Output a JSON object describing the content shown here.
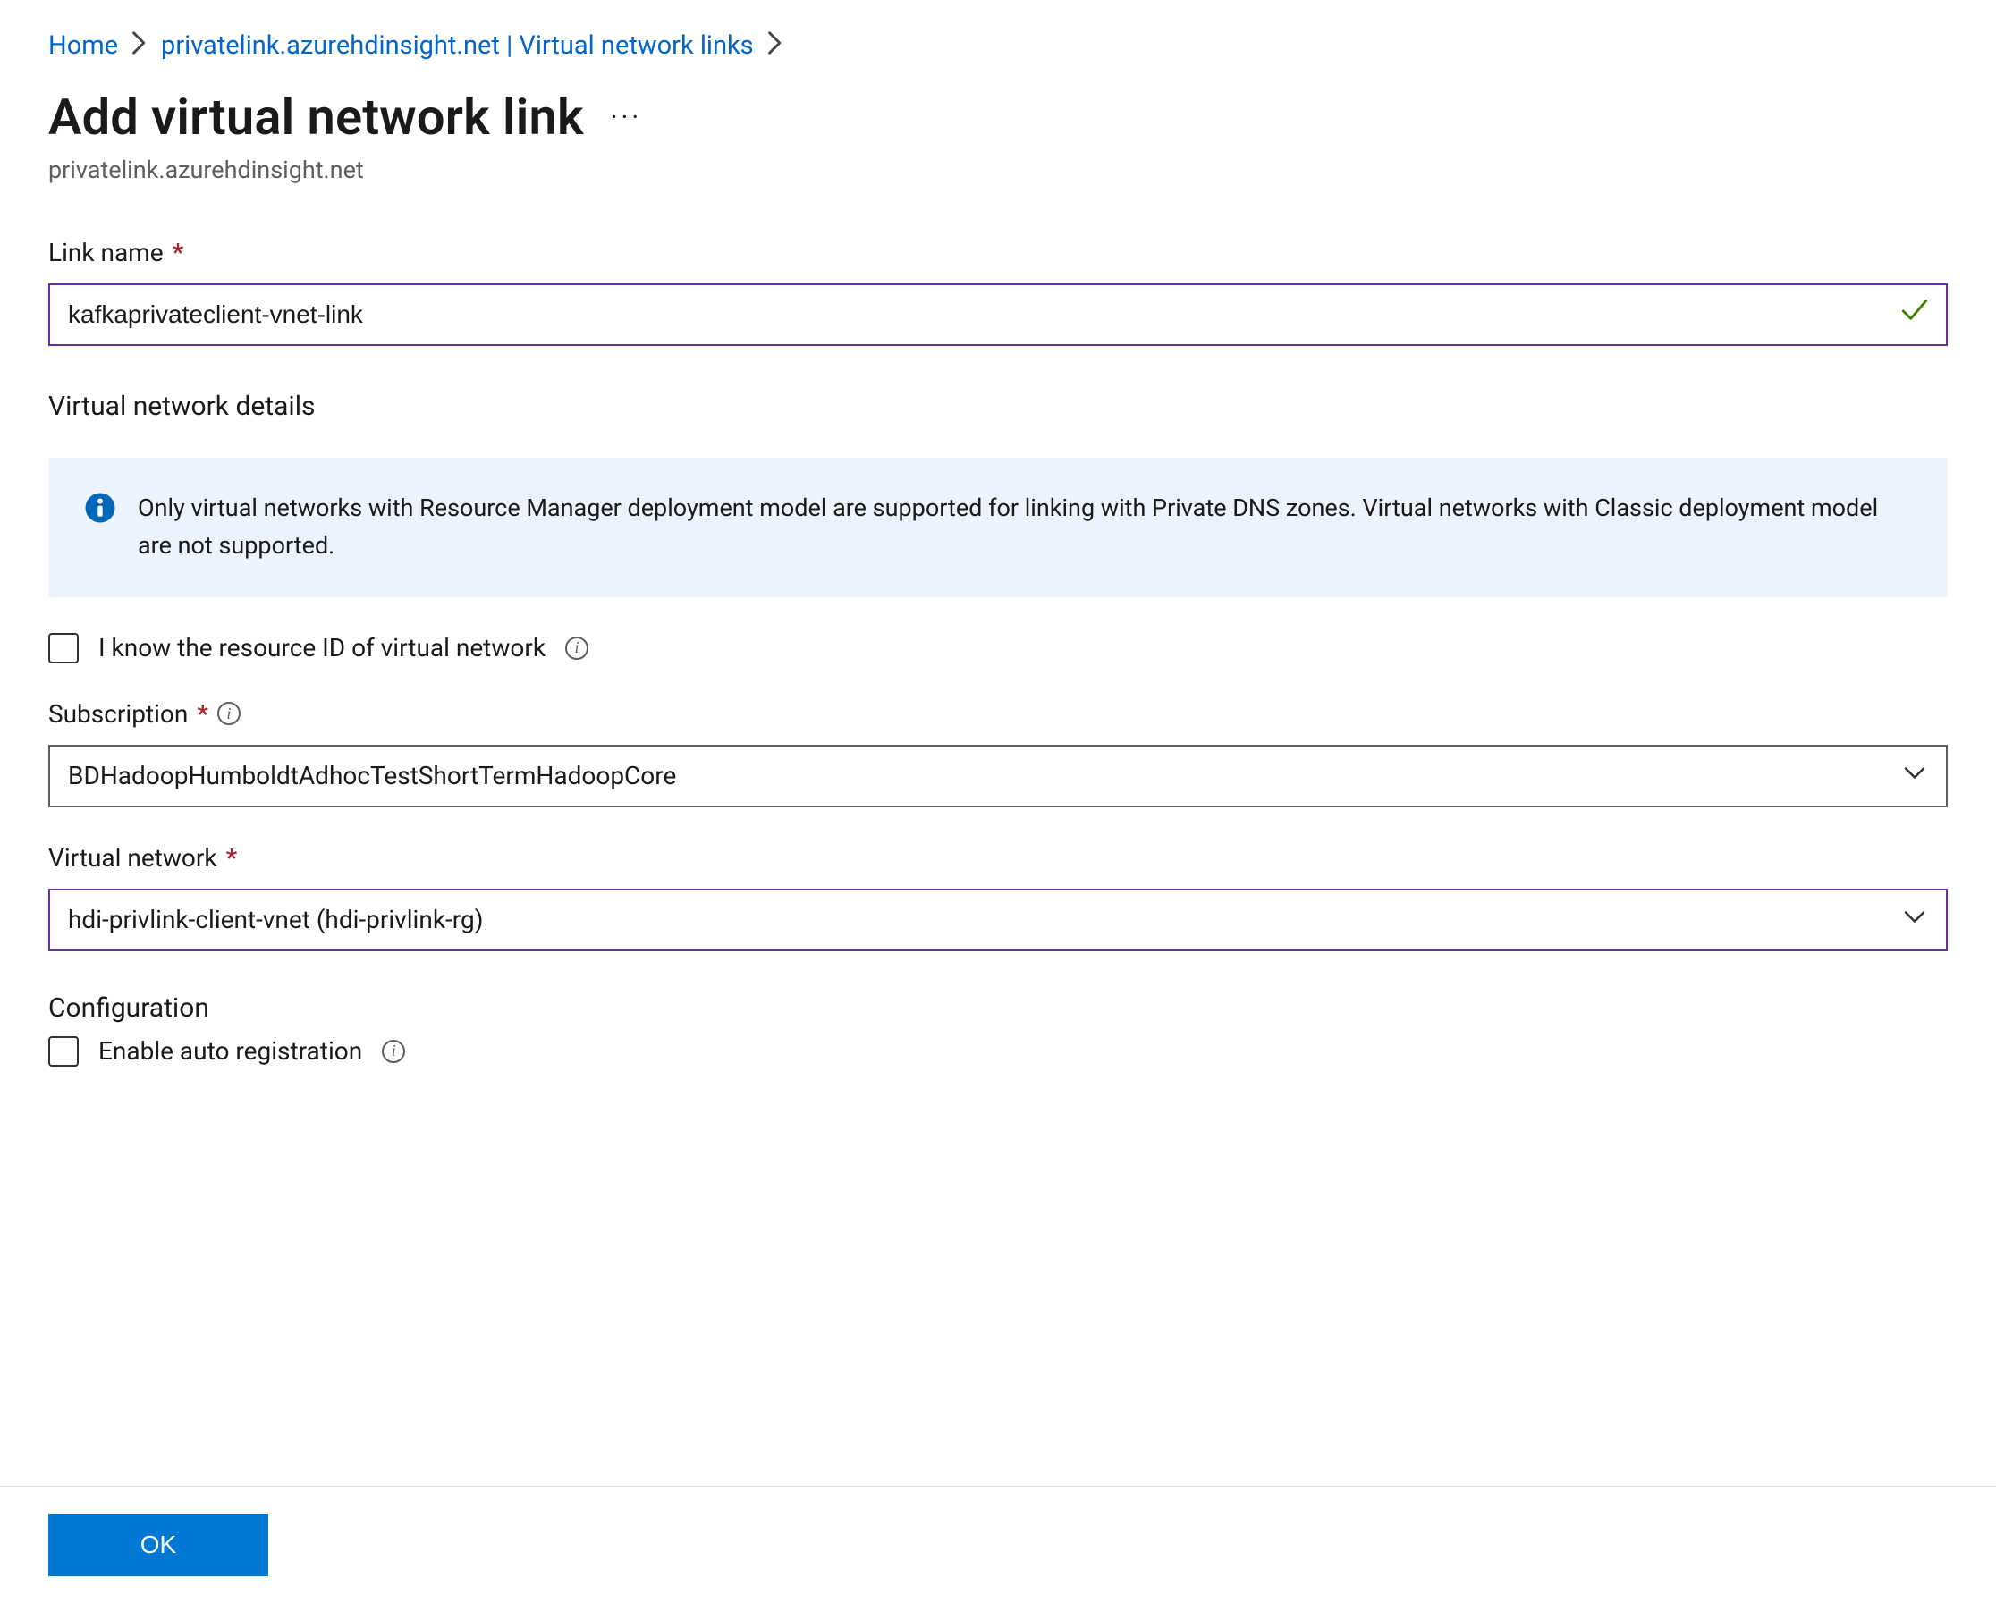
{
  "breadcrumb": {
    "home": "Home",
    "parent": "privatelink.azurehdinsight.net | Virtual network links"
  },
  "header": {
    "title": "Add virtual network link",
    "subtitle": "privatelink.azurehdinsight.net"
  },
  "form": {
    "linkName": {
      "label": "Link name",
      "value": "kafkaprivateclient-vnet-link"
    },
    "vnetDetailsHeading": "Virtual network details",
    "infoBanner": "Only virtual networks with Resource Manager deployment model are supported for linking with Private DNS zones. Virtual networks with Classic deployment model are not supported.",
    "knowResourceId": {
      "label": "I know the resource ID of virtual network",
      "checked": false
    },
    "subscription": {
      "label": "Subscription",
      "value": "BDHadoopHumboldtAdhocTestShortTermHadoopCore"
    },
    "virtualNetwork": {
      "label": "Virtual network",
      "value": "hdi-privlink-client-vnet (hdi-privlink-rg)"
    },
    "configurationHeading": "Configuration",
    "enableAutoReg": {
      "label": "Enable auto registration",
      "checked": false
    }
  },
  "footer": {
    "ok": "OK"
  }
}
